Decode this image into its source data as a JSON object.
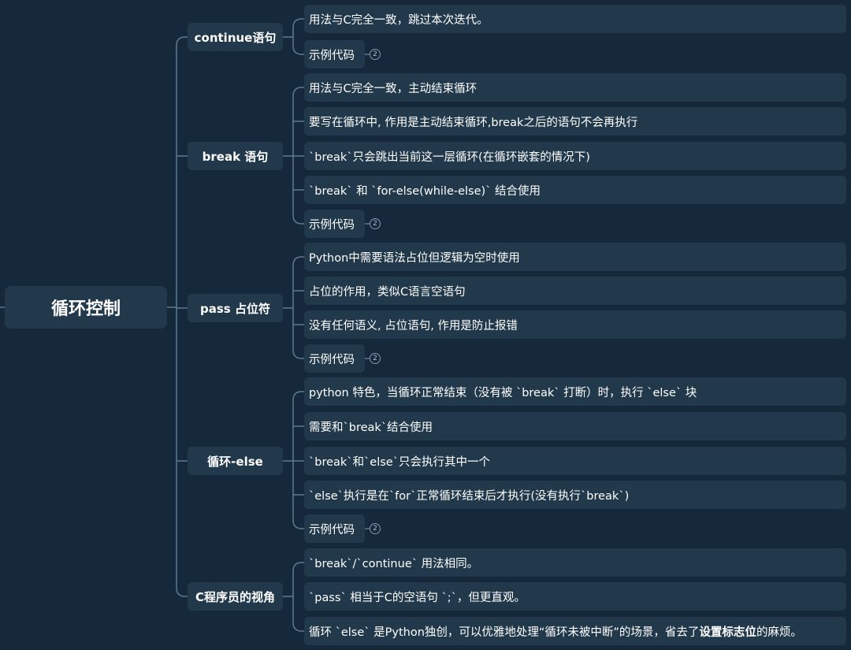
{
  "root": {
    "label": "循环控制"
  },
  "branches": [
    {
      "label": "continue语句"
    },
    {
      "label": "break 语句"
    },
    {
      "label": "pass 占位符"
    },
    {
      "label": "循环-else"
    },
    {
      "label": "C程序员的视角"
    }
  ],
  "leaves": [
    {
      "text": "用法与C完全一致，跳过本次迭代。"
    },
    {
      "text": "示例代码",
      "badge": "2"
    },
    {
      "text": "用法与C完全一致，主动结束循环"
    },
    {
      "text": "要写在循环中, 作用是主动结束循环,break之后的语句不会再执行"
    },
    {
      "text": "`break`只会跳出当前这一层循环(在循环嵌套的情况下)"
    },
    {
      "text": "`break` 和 `for-else(while-else)` 结合使用"
    },
    {
      "text": "示例代码",
      "badge": "2"
    },
    {
      "text": "Python中需要语法占位但逻辑为空时使用"
    },
    {
      "text": "占位的作用，类似C语言空语句"
    },
    {
      "text": "没有任何语义, 占位语句, 作用是防止报错"
    },
    {
      "text": "示例代码",
      "badge": "2"
    },
    {
      "text": "python 特色，当循环正常结束（没有被 `break` 打断）时，执行 `else` 块"
    },
    {
      "text": "需要和`break`结合使用"
    },
    {
      "text": "`break`和`else`只会执行其中一个"
    },
    {
      "text": "`else`执行是在`for`正常循环结束后才执行(没有执行`break`)"
    },
    {
      "text": "示例代码",
      "badge": "2"
    },
    {
      "text": "`break`/`continue` 用法相同。"
    },
    {
      "text": "`pass` 相当于C的空语句 `;`，但更直观。"
    },
    {
      "pre": "循环 `else` 是Python独创，可以优雅地处理“循环未被中断”的场景，省去了",
      "bold": "设置标志位",
      "post": "的麻烦。"
    }
  ]
}
